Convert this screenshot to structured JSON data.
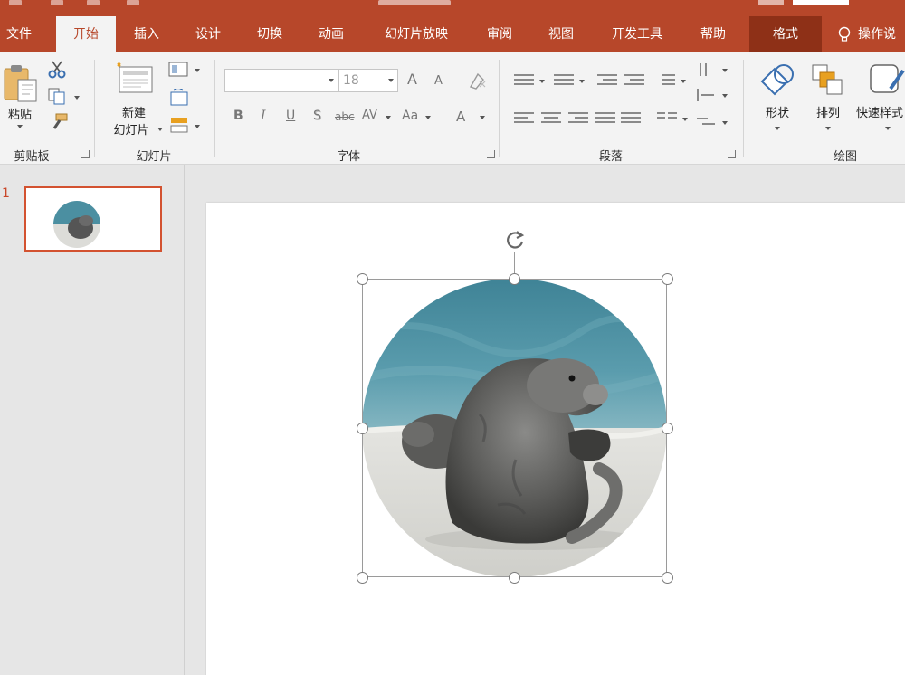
{
  "tabs": [
    {
      "label": "文件",
      "name": "tab-file"
    },
    {
      "label": "开始",
      "name": "tab-home"
    },
    {
      "label": "插入",
      "name": "tab-insert"
    },
    {
      "label": "设计",
      "name": "tab-design"
    },
    {
      "label": "切换",
      "name": "tab-transitions"
    },
    {
      "label": "动画",
      "name": "tab-animations"
    },
    {
      "label": "幻灯片放映",
      "name": "tab-slideshow"
    },
    {
      "label": "审阅",
      "name": "tab-review"
    },
    {
      "label": "视图",
      "name": "tab-view"
    },
    {
      "label": "开发工具",
      "name": "tab-developer"
    },
    {
      "label": "帮助",
      "name": "tab-help"
    },
    {
      "label": "格式",
      "name": "tab-format"
    }
  ],
  "tell_me": "操作说",
  "ribbon": {
    "clipboard": {
      "paste": "粘贴",
      "label": "剪贴板"
    },
    "slides": {
      "new_slide_line1": "新建",
      "new_slide_line2": "幻灯片",
      "label": "幻灯片"
    },
    "font": {
      "font_name": "",
      "font_size": "18",
      "label": "字体",
      "bold": "B",
      "italic": "I",
      "underline": "U",
      "shadow": "S",
      "strike": "abc",
      "spacing": "AV",
      "case": "Aa",
      "grow": "A",
      "shrink": "A",
      "color": "A"
    },
    "paragraph": {
      "label": "段落"
    },
    "drawing": {
      "shape": "形状",
      "arrange": "排列",
      "quick_styles": "快速样式",
      "label": "绘图"
    }
  },
  "thumbnails": [
    {
      "number": "1"
    }
  ],
  "colors": {
    "accent": "#b7472a",
    "context_tab": "#8e3017",
    "thumb_border": "#d35230"
  }
}
